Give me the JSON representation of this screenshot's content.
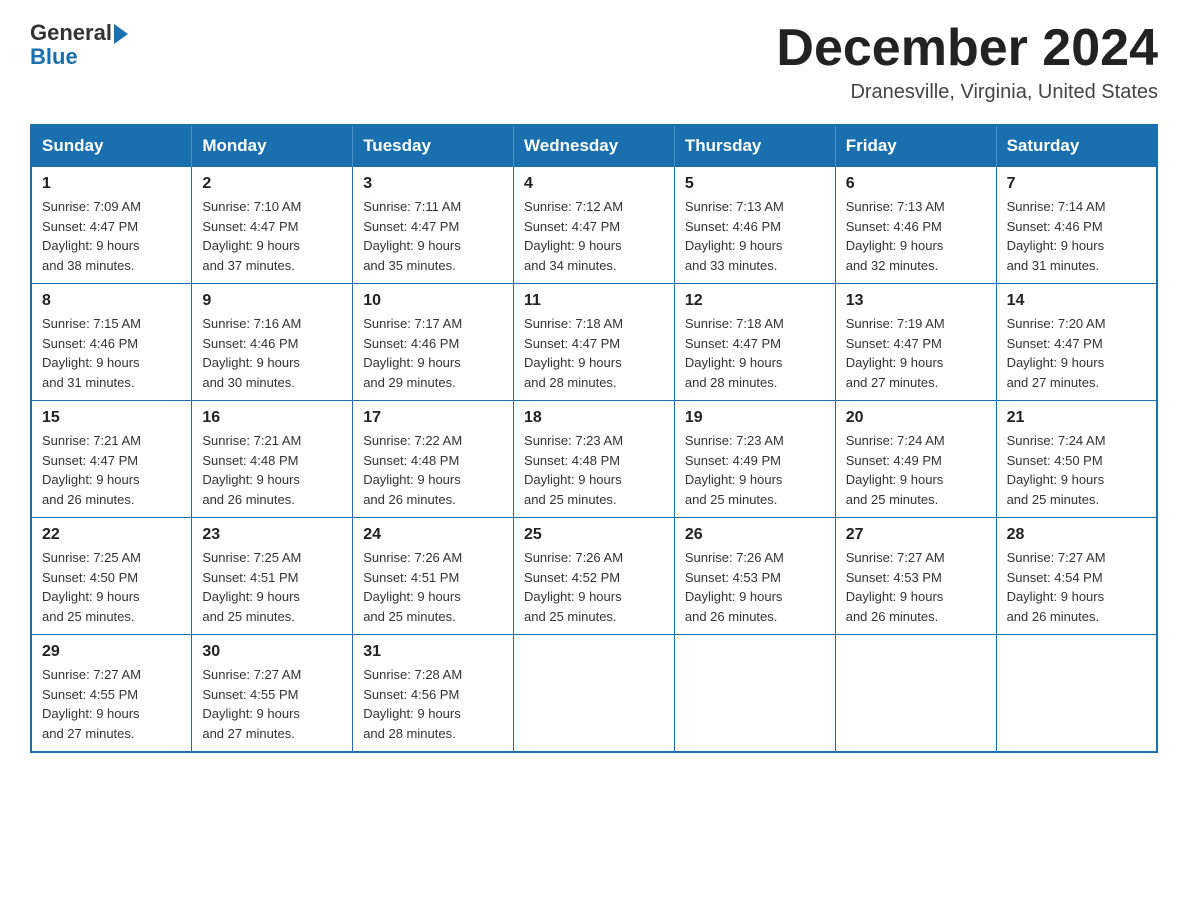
{
  "logo": {
    "general": "General",
    "blue": "Blue"
  },
  "title": "December 2024",
  "location": "Dranesville, Virginia, United States",
  "days_of_week": [
    "Sunday",
    "Monday",
    "Tuesday",
    "Wednesday",
    "Thursday",
    "Friday",
    "Saturday"
  ],
  "weeks": [
    [
      {
        "day": "1",
        "sunrise": "7:09 AM",
        "sunset": "4:47 PM",
        "daylight": "9 hours and 38 minutes."
      },
      {
        "day": "2",
        "sunrise": "7:10 AM",
        "sunset": "4:47 PM",
        "daylight": "9 hours and 37 minutes."
      },
      {
        "day": "3",
        "sunrise": "7:11 AM",
        "sunset": "4:47 PM",
        "daylight": "9 hours and 35 minutes."
      },
      {
        "day": "4",
        "sunrise": "7:12 AM",
        "sunset": "4:47 PM",
        "daylight": "9 hours and 34 minutes."
      },
      {
        "day": "5",
        "sunrise": "7:13 AM",
        "sunset": "4:46 PM",
        "daylight": "9 hours and 33 minutes."
      },
      {
        "day": "6",
        "sunrise": "7:13 AM",
        "sunset": "4:46 PM",
        "daylight": "9 hours and 32 minutes."
      },
      {
        "day": "7",
        "sunrise": "7:14 AM",
        "sunset": "4:46 PM",
        "daylight": "9 hours and 31 minutes."
      }
    ],
    [
      {
        "day": "8",
        "sunrise": "7:15 AM",
        "sunset": "4:46 PM",
        "daylight": "9 hours and 31 minutes."
      },
      {
        "day": "9",
        "sunrise": "7:16 AM",
        "sunset": "4:46 PM",
        "daylight": "9 hours and 30 minutes."
      },
      {
        "day": "10",
        "sunrise": "7:17 AM",
        "sunset": "4:46 PM",
        "daylight": "9 hours and 29 minutes."
      },
      {
        "day": "11",
        "sunrise": "7:18 AM",
        "sunset": "4:47 PM",
        "daylight": "9 hours and 28 minutes."
      },
      {
        "day": "12",
        "sunrise": "7:18 AM",
        "sunset": "4:47 PM",
        "daylight": "9 hours and 28 minutes."
      },
      {
        "day": "13",
        "sunrise": "7:19 AM",
        "sunset": "4:47 PM",
        "daylight": "9 hours and 27 minutes."
      },
      {
        "day": "14",
        "sunrise": "7:20 AM",
        "sunset": "4:47 PM",
        "daylight": "9 hours and 27 minutes."
      }
    ],
    [
      {
        "day": "15",
        "sunrise": "7:21 AM",
        "sunset": "4:47 PM",
        "daylight": "9 hours and 26 minutes."
      },
      {
        "day": "16",
        "sunrise": "7:21 AM",
        "sunset": "4:48 PM",
        "daylight": "9 hours and 26 minutes."
      },
      {
        "day": "17",
        "sunrise": "7:22 AM",
        "sunset": "4:48 PM",
        "daylight": "9 hours and 26 minutes."
      },
      {
        "day": "18",
        "sunrise": "7:23 AM",
        "sunset": "4:48 PM",
        "daylight": "9 hours and 25 minutes."
      },
      {
        "day": "19",
        "sunrise": "7:23 AM",
        "sunset": "4:49 PM",
        "daylight": "9 hours and 25 minutes."
      },
      {
        "day": "20",
        "sunrise": "7:24 AM",
        "sunset": "4:49 PM",
        "daylight": "9 hours and 25 minutes."
      },
      {
        "day": "21",
        "sunrise": "7:24 AM",
        "sunset": "4:50 PM",
        "daylight": "9 hours and 25 minutes."
      }
    ],
    [
      {
        "day": "22",
        "sunrise": "7:25 AM",
        "sunset": "4:50 PM",
        "daylight": "9 hours and 25 minutes."
      },
      {
        "day": "23",
        "sunrise": "7:25 AM",
        "sunset": "4:51 PM",
        "daylight": "9 hours and 25 minutes."
      },
      {
        "day": "24",
        "sunrise": "7:26 AM",
        "sunset": "4:51 PM",
        "daylight": "9 hours and 25 minutes."
      },
      {
        "day": "25",
        "sunrise": "7:26 AM",
        "sunset": "4:52 PM",
        "daylight": "9 hours and 25 minutes."
      },
      {
        "day": "26",
        "sunrise": "7:26 AM",
        "sunset": "4:53 PM",
        "daylight": "9 hours and 26 minutes."
      },
      {
        "day": "27",
        "sunrise": "7:27 AM",
        "sunset": "4:53 PM",
        "daylight": "9 hours and 26 minutes."
      },
      {
        "day": "28",
        "sunrise": "7:27 AM",
        "sunset": "4:54 PM",
        "daylight": "9 hours and 26 minutes."
      }
    ],
    [
      {
        "day": "29",
        "sunrise": "7:27 AM",
        "sunset": "4:55 PM",
        "daylight": "9 hours and 27 minutes."
      },
      {
        "day": "30",
        "sunrise": "7:27 AM",
        "sunset": "4:55 PM",
        "daylight": "9 hours and 27 minutes."
      },
      {
        "day": "31",
        "sunrise": "7:28 AM",
        "sunset": "4:56 PM",
        "daylight": "9 hours and 28 minutes."
      },
      null,
      null,
      null,
      null
    ]
  ]
}
